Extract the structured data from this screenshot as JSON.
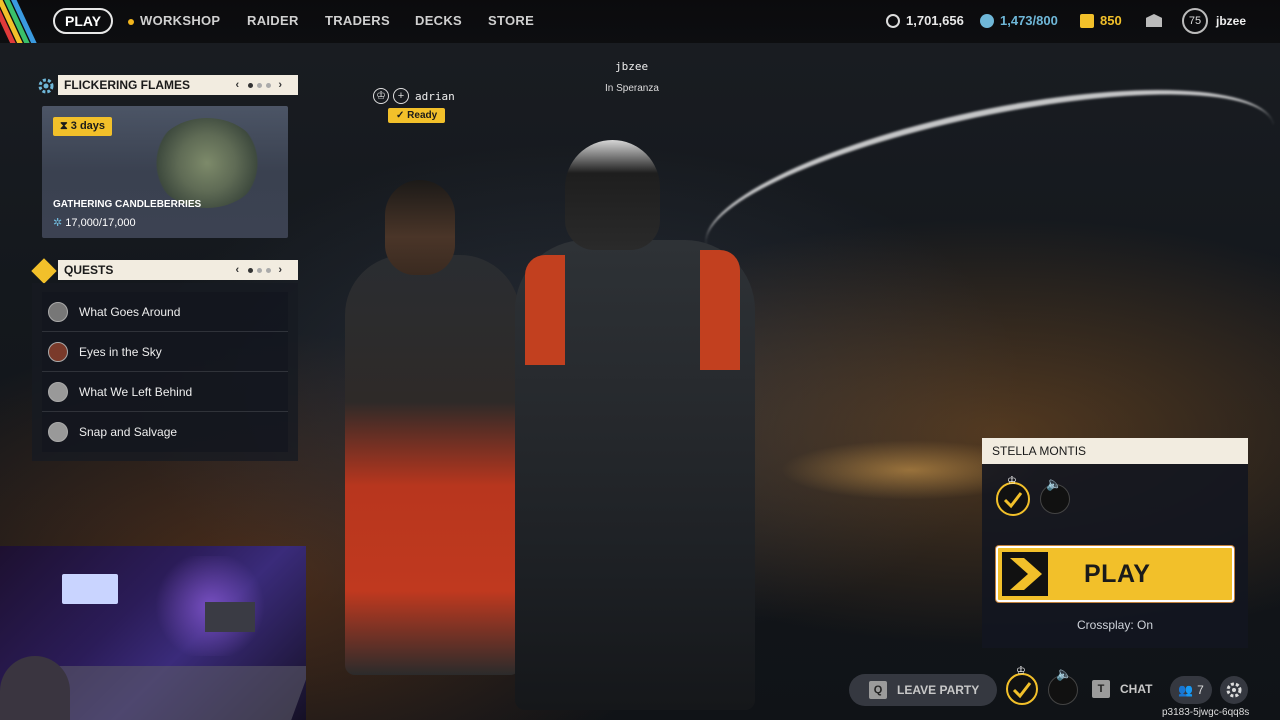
{
  "nav": {
    "play": "PLAY",
    "items": [
      "WORKSHOP",
      "RAIDER",
      "TRADERS",
      "DECKS",
      "STORE"
    ],
    "coins": "1,701,656",
    "credits": "1,473/800",
    "tokens": "850",
    "level": "75",
    "username": "jbzee"
  },
  "event": {
    "title": "FLICKERING FLAMES",
    "days": "3 days",
    "name": "GATHERING CANDLEBERRIES",
    "progress": "17,000/17,000"
  },
  "quests": {
    "title": "QUESTS",
    "items": [
      "What Goes Around",
      "Eyes in the Sky",
      "What We Left Behind",
      "Snap and Salvage"
    ]
  },
  "party": {
    "member1": "adrian",
    "ready": "Ready",
    "member2": "jbzee",
    "location": "In Speranza"
  },
  "play_panel": {
    "map": "STELLA MONTIS",
    "play": "PLAY",
    "crossplay": "Crossplay: On"
  },
  "bottom": {
    "leave_key": "Q",
    "leave_party": "LEAVE PARTY",
    "chat_key": "T",
    "chat": "CHAT",
    "friends": "7",
    "session_id": "p3183-5jwgc-6qq8s"
  },
  "colors": {
    "accent": "#f2c02a",
    "panel_header": "#f2ece0"
  }
}
